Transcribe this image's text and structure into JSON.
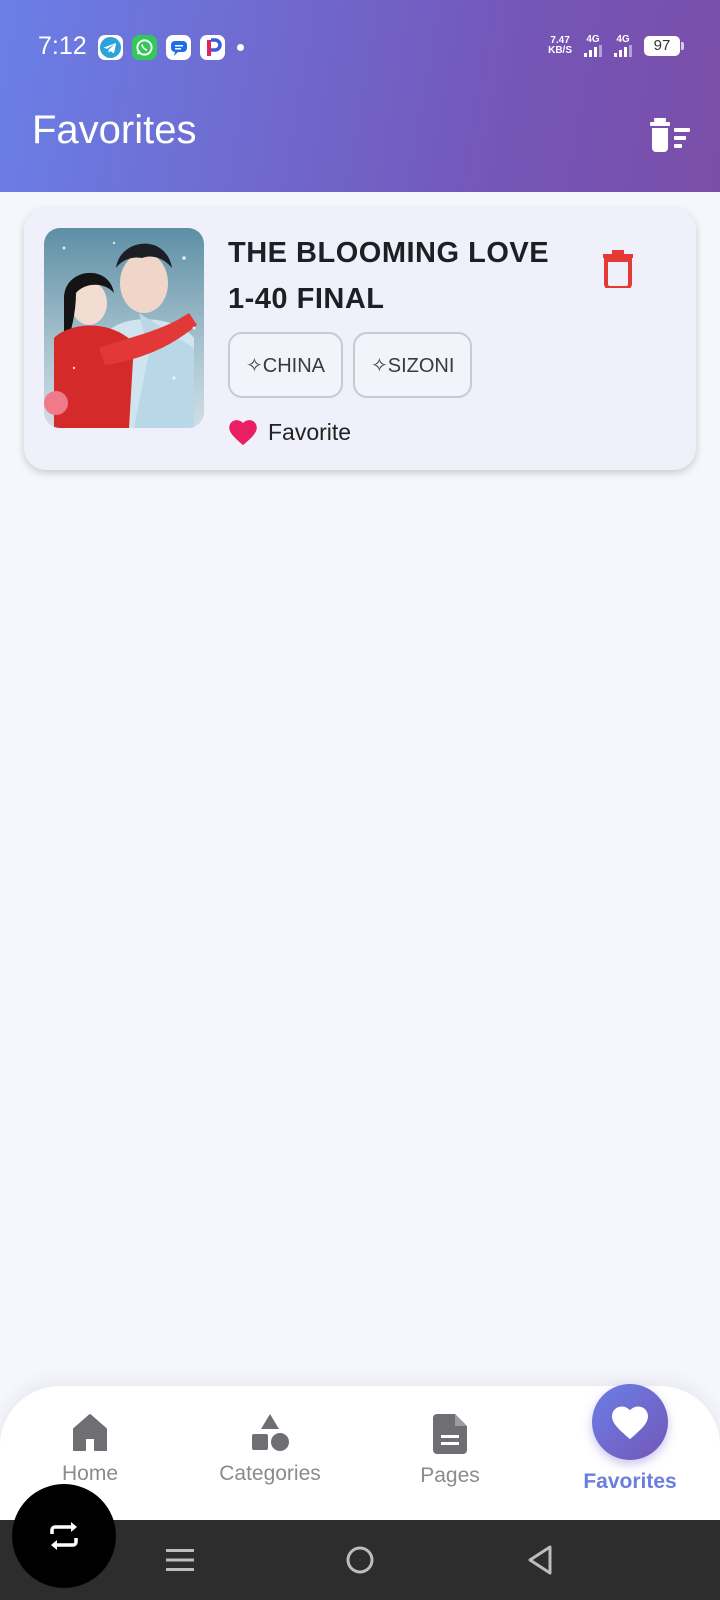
{
  "status_bar": {
    "time": "7:12",
    "net_speed_value": "7.47",
    "net_speed_unit": "KB/S",
    "sim1": "4G",
    "sim2": "4G",
    "battery": "97",
    "notification_icons": [
      "telegram-icon",
      "whatsapp-icon",
      "messages-icon",
      "p-app-icon"
    ]
  },
  "header": {
    "title": "Favorites",
    "clear_all_icon": "delete-sweep-icon"
  },
  "favorites": [
    {
      "title_line1": "THE BLOOMING LOVE",
      "title_line2": "1-40 FINAL",
      "tags": [
        "✧CHINA",
        "✧SIZONI"
      ],
      "favorite_label": "Favorite"
    }
  ],
  "bottom_nav": {
    "items": [
      {
        "label": "Home",
        "icon": "home-icon"
      },
      {
        "label": "Categories",
        "icon": "category-icon"
      },
      {
        "label": "Pages",
        "icon": "document-icon"
      },
      {
        "label": "Favorites",
        "icon": "heart-icon",
        "active": true
      }
    ]
  },
  "colors": {
    "header_start": "#6a7fe7",
    "header_end": "#7456b8",
    "delete_red": "#e53935",
    "heart_pink": "#e91e63",
    "active_nav": "#6c7de0"
  }
}
